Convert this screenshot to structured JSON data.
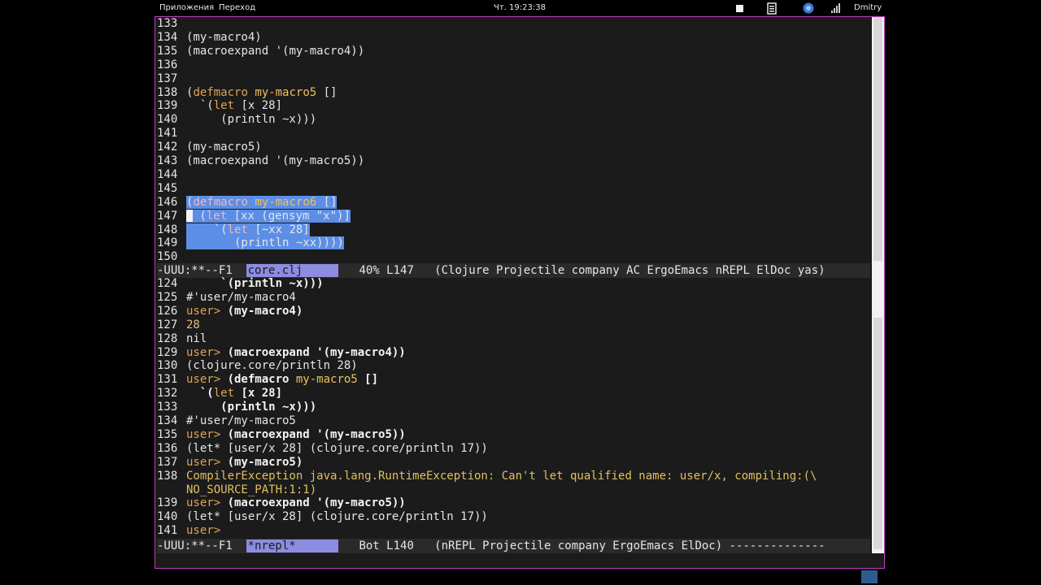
{
  "panel": {
    "apps_menu": "Приложения",
    "places_menu": "Переход",
    "clock": "Чт. 19:23:38",
    "user": "Dmitry"
  },
  "top_pane": {
    "lines": [
      {
        "n": "133",
        "segs": [
          {
            "t": "",
            "c": ""
          }
        ]
      },
      {
        "n": "134",
        "segs": [
          {
            "t": "(my-macro4)",
            "c": ""
          }
        ]
      },
      {
        "n": "135",
        "segs": [
          {
            "t": "(",
            "c": ""
          },
          {
            "t": "macroexpand",
            "c": ""
          },
          {
            "t": " '(my-macro4))",
            "c": ""
          }
        ]
      },
      {
        "n": "136",
        "segs": [
          {
            "t": "",
            "c": ""
          }
        ]
      },
      {
        "n": "137",
        "segs": [
          {
            "t": "",
            "c": ""
          }
        ]
      },
      {
        "n": "138",
        "segs": [
          {
            "t": "(",
            "c": ""
          },
          {
            "t": "defmacro",
            "c": "kw"
          },
          {
            "t": " ",
            "c": ""
          },
          {
            "t": "my-macro5",
            "c": "fn"
          },
          {
            "t": " []",
            "c": ""
          }
        ]
      },
      {
        "n": "139",
        "segs": [
          {
            "t": "  `(",
            "c": ""
          },
          {
            "t": "let",
            "c": "kw"
          },
          {
            "t": " [x 28]",
            "c": ""
          }
        ]
      },
      {
        "n": "140",
        "segs": [
          {
            "t": "     (println ~x)))",
            "c": ""
          }
        ]
      },
      {
        "n": "141",
        "segs": [
          {
            "t": "",
            "c": ""
          }
        ]
      },
      {
        "n": "142",
        "segs": [
          {
            "t": "(my-macro5)",
            "c": ""
          }
        ]
      },
      {
        "n": "143",
        "segs": [
          {
            "t": "(macroexpand '(my-macro5))",
            "c": ""
          }
        ]
      },
      {
        "n": "144",
        "segs": [
          {
            "t": "",
            "c": ""
          }
        ]
      },
      {
        "n": "145",
        "segs": [
          {
            "t": "",
            "c": ""
          }
        ]
      },
      {
        "n": "146",
        "hl": "lite",
        "segs": [
          {
            "t": "(",
            "c": ""
          },
          {
            "t": "defmacro",
            "c": "kw2"
          },
          {
            "t": " ",
            "c": ""
          },
          {
            "t": "my-macro6",
            "c": "fn"
          },
          {
            "t": " []",
            "c": ""
          }
        ]
      },
      {
        "n": "147",
        "hl": "full",
        "cursor": true,
        "segs": [
          {
            "t": " (",
            "c": ""
          },
          {
            "t": "let",
            "c": "kw2"
          },
          {
            "t": " [xx (gensym \"x\")]",
            "c": ""
          }
        ]
      },
      {
        "n": "148",
        "hl": "full",
        "segs": [
          {
            "t": "    `(",
            "c": ""
          },
          {
            "t": "let",
            "c": "kw2"
          },
          {
            "t": " [~xx 28]",
            "c": ""
          }
        ]
      },
      {
        "n": "149",
        "hl": "full",
        "segs": [
          {
            "t": "       (println ~xx))))",
            "c": ""
          }
        ]
      },
      {
        "n": "150",
        "segs": [
          {
            "t": "",
            "c": ""
          }
        ]
      }
    ]
  },
  "top_modeline": {
    "left": "-UUU:**--F1  ",
    "buffer": "core.clj     ",
    "right": "   40% L147   (Clojure Projectile company AC ErgoEmacs nREPL ElDoc yas)"
  },
  "bottom_pane": {
    "lines": [
      {
        "n": "124",
        "segs": [
          {
            "t": "     `(println ~x)))",
            "c": "inp"
          }
        ]
      },
      {
        "n": "125",
        "segs": [
          {
            "t": "#'user/my-macro4",
            "c": ""
          }
        ]
      },
      {
        "n": "126",
        "segs": [
          {
            "t": "user> ",
            "c": "prompt"
          },
          {
            "t": "(my-macro4)",
            "c": "inp"
          }
        ]
      },
      {
        "n": "127",
        "segs": [
          {
            "t": "28",
            "c": "num"
          }
        ]
      },
      {
        "n": "128",
        "segs": [
          {
            "t": "nil",
            "c": ""
          }
        ]
      },
      {
        "n": "129",
        "segs": [
          {
            "t": "user> ",
            "c": "prompt"
          },
          {
            "t": "(macroexpand '(my-macro4))",
            "c": "inp"
          }
        ]
      },
      {
        "n": "130",
        "segs": [
          {
            "t": "(clojure.core/println 28)",
            "c": ""
          }
        ]
      },
      {
        "n": "131",
        "segs": [
          {
            "t": "user> ",
            "c": "prompt"
          },
          {
            "t": "(defmacro ",
            "c": "inp"
          },
          {
            "t": "my-macro5",
            "c": "fn"
          },
          {
            "t": " []",
            "c": "inp"
          }
        ]
      },
      {
        "n": "132",
        "segs": [
          {
            "t": "  `(",
            "c": "inp"
          },
          {
            "t": "let",
            "c": "kw"
          },
          {
            "t": " [x 28]",
            "c": "inp"
          }
        ]
      },
      {
        "n": "133",
        "segs": [
          {
            "t": "     (println ~x)))",
            "c": "inp"
          }
        ]
      },
      {
        "n": "134",
        "segs": [
          {
            "t": "#'user/my-macro5",
            "c": ""
          }
        ]
      },
      {
        "n": "135",
        "segs": [
          {
            "t": "user> ",
            "c": "prompt"
          },
          {
            "t": "(macroexpand '(my-macro5))",
            "c": "inp"
          }
        ]
      },
      {
        "n": "136",
        "segs": [
          {
            "t": "(let* [user/x 28] (clojure.core/println 17))",
            "c": ""
          }
        ]
      },
      {
        "n": "137",
        "segs": [
          {
            "t": "user> ",
            "c": "prompt"
          },
          {
            "t": "(my-macro5)",
            "c": "inp"
          }
        ]
      },
      {
        "n": "138",
        "segs": [
          {
            "t": "CompilerException java.lang.RuntimeException: Can't let qualified name: user/x, compiling:(\\",
            "c": "err"
          }
        ]
      },
      {
        "n": "",
        "segs": [
          {
            "t": "NO_SOURCE_PATH:1:1)",
            "c": "err"
          }
        ]
      },
      {
        "n": "139",
        "segs": [
          {
            "t": "user> ",
            "c": "prompt"
          },
          {
            "t": "(macroexpand '(my-macro5))",
            "c": "inp"
          }
        ]
      },
      {
        "n": "140",
        "segs": [
          {
            "t": "(let* [user/x 28] (clojure.core/println 17))",
            "c": ""
          }
        ]
      },
      {
        "n": "141",
        "segs": [
          {
            "t": "user> ",
            "c": "prompt"
          }
        ]
      }
    ]
  },
  "bottom_modeline": {
    "left": "-UUU:**--F1  ",
    "buffer": "*nrepl*      ",
    "right": "   Bot L140   (nREPL Projectile company ErgoEmacs ElDoc) --------------"
  }
}
